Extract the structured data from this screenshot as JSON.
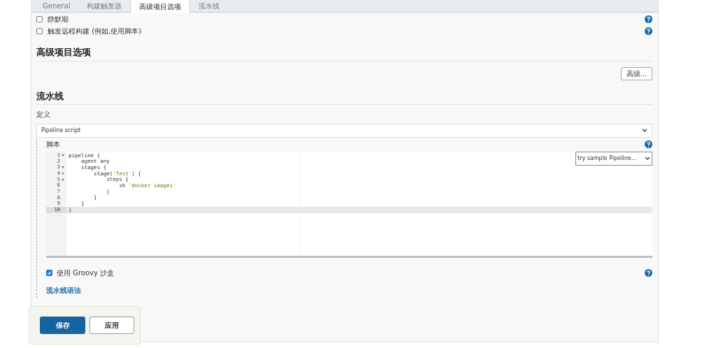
{
  "tabs": [
    {
      "label": "General",
      "selected": false
    },
    {
      "label": "构建触发器",
      "selected": false
    },
    {
      "label": "高级项目选项",
      "selected": true
    },
    {
      "label": "流水线",
      "selected": false
    }
  ],
  "trigger_options": [
    {
      "label": "静默期",
      "checked": false
    },
    {
      "label": "触发远程构建 (例如,使用脚本)",
      "checked": false
    }
  ],
  "advanced_section": {
    "heading": "高级项目选项",
    "button": "高级..."
  },
  "pipeline_section": {
    "heading": "流水线",
    "definition_label": "定义",
    "definition_value": "Pipeline script",
    "script_label": "脚本",
    "sample_select": "try sample Pipeline...",
    "code_lines": [
      {
        "number": "1",
        "foldable": true,
        "active": false,
        "tokens": [
          {
            "kind": "plain",
            "text": "pipeline {"
          }
        ]
      },
      {
        "number": "2",
        "foldable": false,
        "active": false,
        "tokens": [
          {
            "kind": "plain",
            "text": "    agent any"
          }
        ]
      },
      {
        "number": "3",
        "foldable": true,
        "active": false,
        "tokens": [
          {
            "kind": "plain",
            "text": "    stages {"
          }
        ]
      },
      {
        "number": "4",
        "foldable": true,
        "active": false,
        "tokens": [
          {
            "kind": "plain",
            "text": "        stage("
          },
          {
            "kind": "string",
            "text": "'Test'"
          },
          {
            "kind": "plain",
            "text": ") {"
          }
        ]
      },
      {
        "number": "5",
        "foldable": true,
        "active": false,
        "tokens": [
          {
            "kind": "plain",
            "text": "            steps {"
          }
        ]
      },
      {
        "number": "6",
        "foldable": false,
        "active": false,
        "tokens": [
          {
            "kind": "plain",
            "text": "                sh "
          },
          {
            "kind": "string",
            "text": "'docker images'"
          }
        ]
      },
      {
        "number": "7",
        "foldable": false,
        "active": false,
        "tokens": [
          {
            "kind": "plain",
            "text": "            }"
          }
        ]
      },
      {
        "number": "8",
        "foldable": false,
        "active": false,
        "tokens": [
          {
            "kind": "plain",
            "text": "        }"
          }
        ]
      },
      {
        "number": "9",
        "foldable": false,
        "active": false,
        "tokens": [
          {
            "kind": "plain",
            "text": "    }"
          }
        ]
      },
      {
        "number": "10",
        "foldable": false,
        "active": true,
        "tokens": [
          {
            "kind": "plain",
            "text": "}"
          }
        ]
      }
    ],
    "sandbox": {
      "label": "使用 Groovy 沙盒",
      "checked": true
    },
    "syntax_link": "流水线语法"
  },
  "actions": [
    {
      "label": "保存",
      "kind": "primary"
    },
    {
      "label": "应用",
      "kind": "secondary"
    }
  ]
}
